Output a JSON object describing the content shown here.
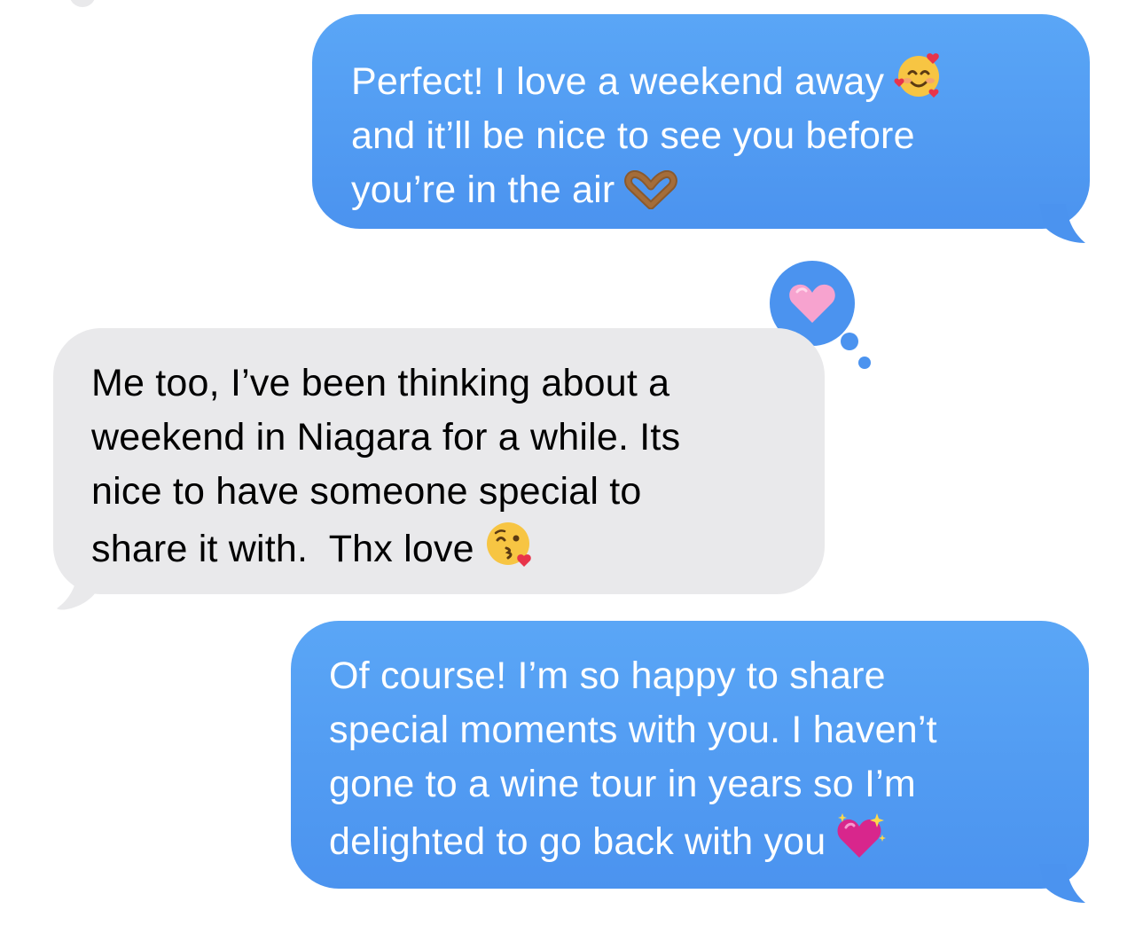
{
  "conversation": {
    "messages": [
      {
        "direction": "sent",
        "lines": [
          "Perfect! I love a weekend away",
          "and it’ll be nice to see you before",
          "you’re in the air"
        ],
        "emojis": [
          "smiling-face-with-hearts",
          "heart-hands"
        ]
      },
      {
        "direction": "received",
        "lines": [
          "Me too, I’ve been thinking about a",
          "weekend in Niagara for a while. Its",
          "nice to have someone special to",
          "share it with.  Thx love"
        ],
        "emojis": [
          "face-blowing-a-kiss"
        ],
        "tapback": "pink-heart"
      },
      {
        "direction": "sent",
        "lines": [
          "Of course! I’m so happy to share",
          "special moments with you. I haven’t",
          "gone to a wine tour in years so I’m",
          "delighted to go back with you"
        ],
        "emojis": [
          "sparkling-heart"
        ]
      }
    ]
  },
  "colors": {
    "sent_bubble": "#4b93ef",
    "received_bubble": "#e9e9eb",
    "sent_text": "#ffffff",
    "received_text": "#000000",
    "tapback_heart": "#f7a3cf"
  }
}
